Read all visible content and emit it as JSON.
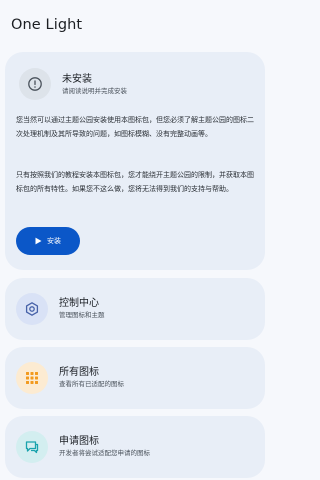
{
  "app": {
    "title": "One Light"
  },
  "install_card": {
    "title": "未安装",
    "subtitle": "请阅读说明并完成安装",
    "paragraph1": "您当然可以通过主题公园安装使用本图标包，但您必须了解主题公园的图标二次处理机制及其所导致的问题，如图标模糊、没有完整动画等。",
    "paragraph2": "只有按照我们的教程安装本图标包，您才能绕开主题公园的限制，并获取本图标包的所有特性。如果您不这么做，您将无法得到我们的支持与帮助。",
    "button_label": "安装",
    "icon": "warning-info-icon"
  },
  "menu": [
    {
      "title": "控制中心",
      "subtitle": "管理图标和主题",
      "icon": "gear-icon",
      "icon_color": "#4661a8",
      "circle_color": "#d9e2f6"
    },
    {
      "title": "所有图标",
      "subtitle": "查看所有已适配的图标",
      "icon": "grid-icon",
      "icon_color": "#f29a1e",
      "circle_color": "#fcebd2"
    },
    {
      "title": "申请图标",
      "subtitle": "开发者将尝试适配您申请的图标",
      "icon": "chat-bubble-icon",
      "icon_color": "#1aa3ad",
      "circle_color": "#d3eef0"
    }
  ],
  "colors": {
    "background": "#f6f8fc",
    "card": "#e8eef7",
    "accent": "#0b57c8"
  }
}
